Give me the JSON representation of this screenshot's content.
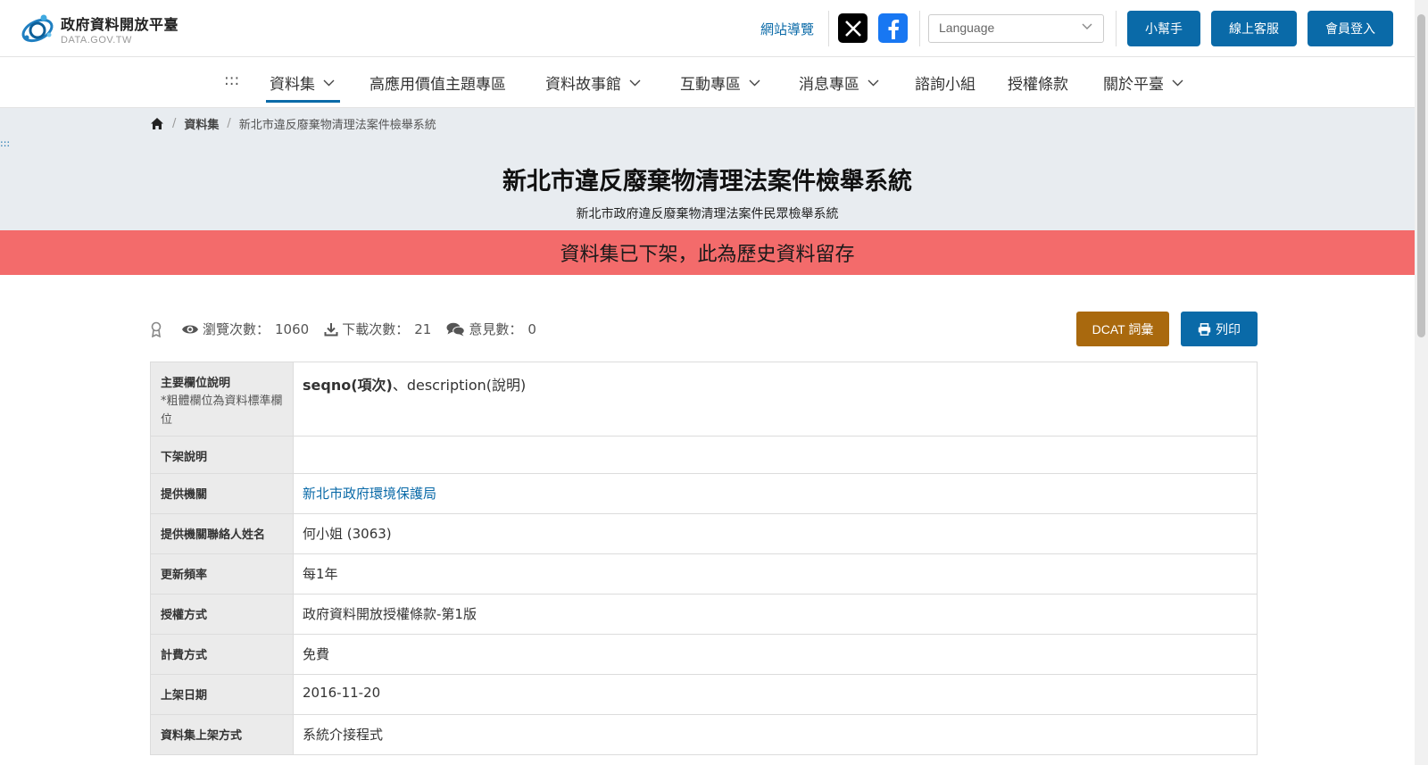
{
  "header": {
    "logo_title": "政府資料開放平臺",
    "logo_sub": "DATA.GOV.TW",
    "sitemap": "網站導覽",
    "language_placeholder": "Language",
    "helper_button": "小幫手",
    "service_button": "線上客服",
    "login_button": "會員登入"
  },
  "nav": {
    "menu_anchor": ":::",
    "items": [
      "資料集",
      "高應用價值主題專區",
      "資料故事館",
      "互動專區",
      "消息專區",
      "諮詢小組",
      "授權條款",
      "關於平臺"
    ]
  },
  "breadcrumb": {
    "section": "資料集",
    "current": "新北市違反廢棄物清理法案件檢舉系統"
  },
  "page": {
    "side_anchor": ":::",
    "title": "新北市違反廢棄物清理法案件檢舉系統",
    "subtitle": "新北市政府違反廢棄物清理法案件民眾檢舉系統",
    "alert": "資料集已下架，此為歷史資料留存"
  },
  "stats": {
    "views_label": "瀏覽次數：",
    "views": "1060",
    "downloads_label": "下載次數：",
    "downloads": "21",
    "comments_label": "意見數：",
    "comments": "0",
    "dcat_button": "DCAT 詞彙",
    "print_button": "列印"
  },
  "fields": {
    "main_label": "主要欄位說明",
    "main_note": "*粗體欄位為資料標準欄位",
    "main_value_bold": "seqno(項次)",
    "main_value_rest": "、description(說明)",
    "rows": [
      {
        "label": "下架說明",
        "value": ""
      },
      {
        "label": "提供機關",
        "value": "新北市政府環境保護局"
      },
      {
        "label": "提供機關聯絡人姓名",
        "value": "何小姐 (3063)"
      },
      {
        "label": "更新頻率",
        "value": "每1年"
      },
      {
        "label": "授權方式",
        "value": "政府資料開放授權條款-第1版"
      },
      {
        "label": "計費方式",
        "value": "免費"
      },
      {
        "label": "上架日期",
        "value": "2016-11-20"
      },
      {
        "label": "資料集上架方式",
        "value": "系統介接程式"
      }
    ]
  },
  "colors": {
    "primary": "#0a6aa8",
    "alert_bg": "#f36b6b",
    "dcat": "#a9690e"
  }
}
